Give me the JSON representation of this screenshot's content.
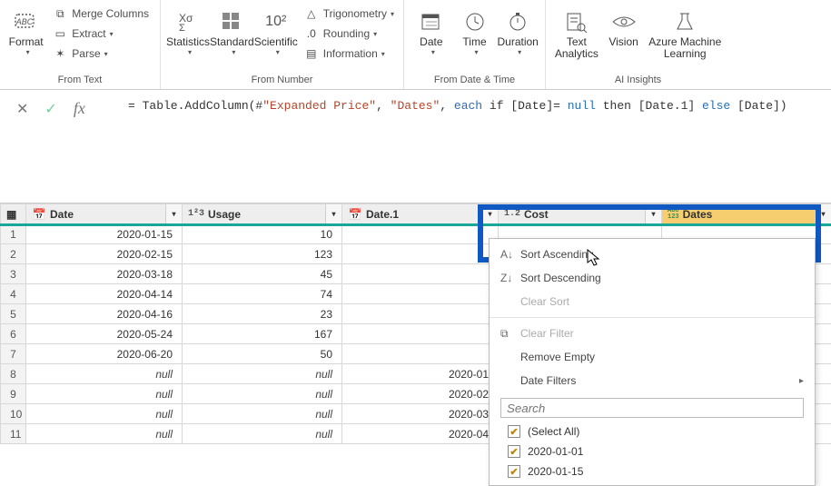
{
  "ribbon": {
    "format": {
      "label": "Format"
    },
    "merge": "Merge Columns",
    "extract": "Extract",
    "parse": "Parse",
    "from_text": "From Text",
    "stats": "Statistics",
    "standard": "Standard",
    "scientific": "Scientific",
    "trig": "Trigonometry",
    "rounding": "Rounding",
    "information": "Information",
    "from_number": "From Number",
    "date": "Date",
    "time": "Time",
    "duration": "Duration",
    "from_datetime": "From Date & Time",
    "text_analytics": "Text\nAnalytics",
    "vision": "Vision",
    "aml": "Azure Machine\nLearning",
    "ai": "AI Insights"
  },
  "formula": {
    "prefix": "= Table.AddColumn(#",
    "arg1": "\"Expanded Price\"",
    "sep1": ", ",
    "arg2": "\"Dates\"",
    "sep2": ", ",
    "kw_each": "each",
    "txt1": " if [Date]= ",
    "kw_null": "null",
    "txt2": " then [Date.1] ",
    "kw_else": "else",
    "txt3": " [Date])"
  },
  "cols": {
    "date": "Date",
    "usage": "Usage",
    "usage_type": "1²3",
    "date1": "Date.1",
    "cost": "Cost",
    "cost_type": "1.2",
    "dates": "Dates",
    "dates_type": "ABC\n123"
  },
  "rows": [
    {
      "idx": "1",
      "date": "2020-01-15",
      "usage": "10",
      "date1": ""
    },
    {
      "idx": "2",
      "date": "2020-02-15",
      "usage": "123",
      "date1": ""
    },
    {
      "idx": "3",
      "date": "2020-03-18",
      "usage": "45",
      "date1": ""
    },
    {
      "idx": "4",
      "date": "2020-04-14",
      "usage": "74",
      "date1": ""
    },
    {
      "idx": "5",
      "date": "2020-04-16",
      "usage": "23",
      "date1": ""
    },
    {
      "idx": "6",
      "date": "2020-05-24",
      "usage": "167",
      "date1": ""
    },
    {
      "idx": "7",
      "date": "2020-06-20",
      "usage": "50",
      "date1": ""
    },
    {
      "idx": "8",
      "date": "null",
      "usage": "null",
      "date1": "2020-01"
    },
    {
      "idx": "9",
      "date": "null",
      "usage": "null",
      "date1": "2020-02"
    },
    {
      "idx": "10",
      "date": "null",
      "usage": "null",
      "date1": "2020-03"
    },
    {
      "idx": "11",
      "date": "null",
      "usage": "null",
      "date1": "2020-04"
    }
  ],
  "menu": {
    "sort_asc": "Sort Ascending",
    "sort_desc": "Sort Descending",
    "clear_sort": "Clear Sort",
    "clear_filter": "Clear Filter",
    "remove_empty": "Remove Empty",
    "date_filters": "Date Filters",
    "search_ph": "Search",
    "select_all": "(Select All)",
    "v1": "2020-01-01",
    "v2": "2020-01-15"
  }
}
